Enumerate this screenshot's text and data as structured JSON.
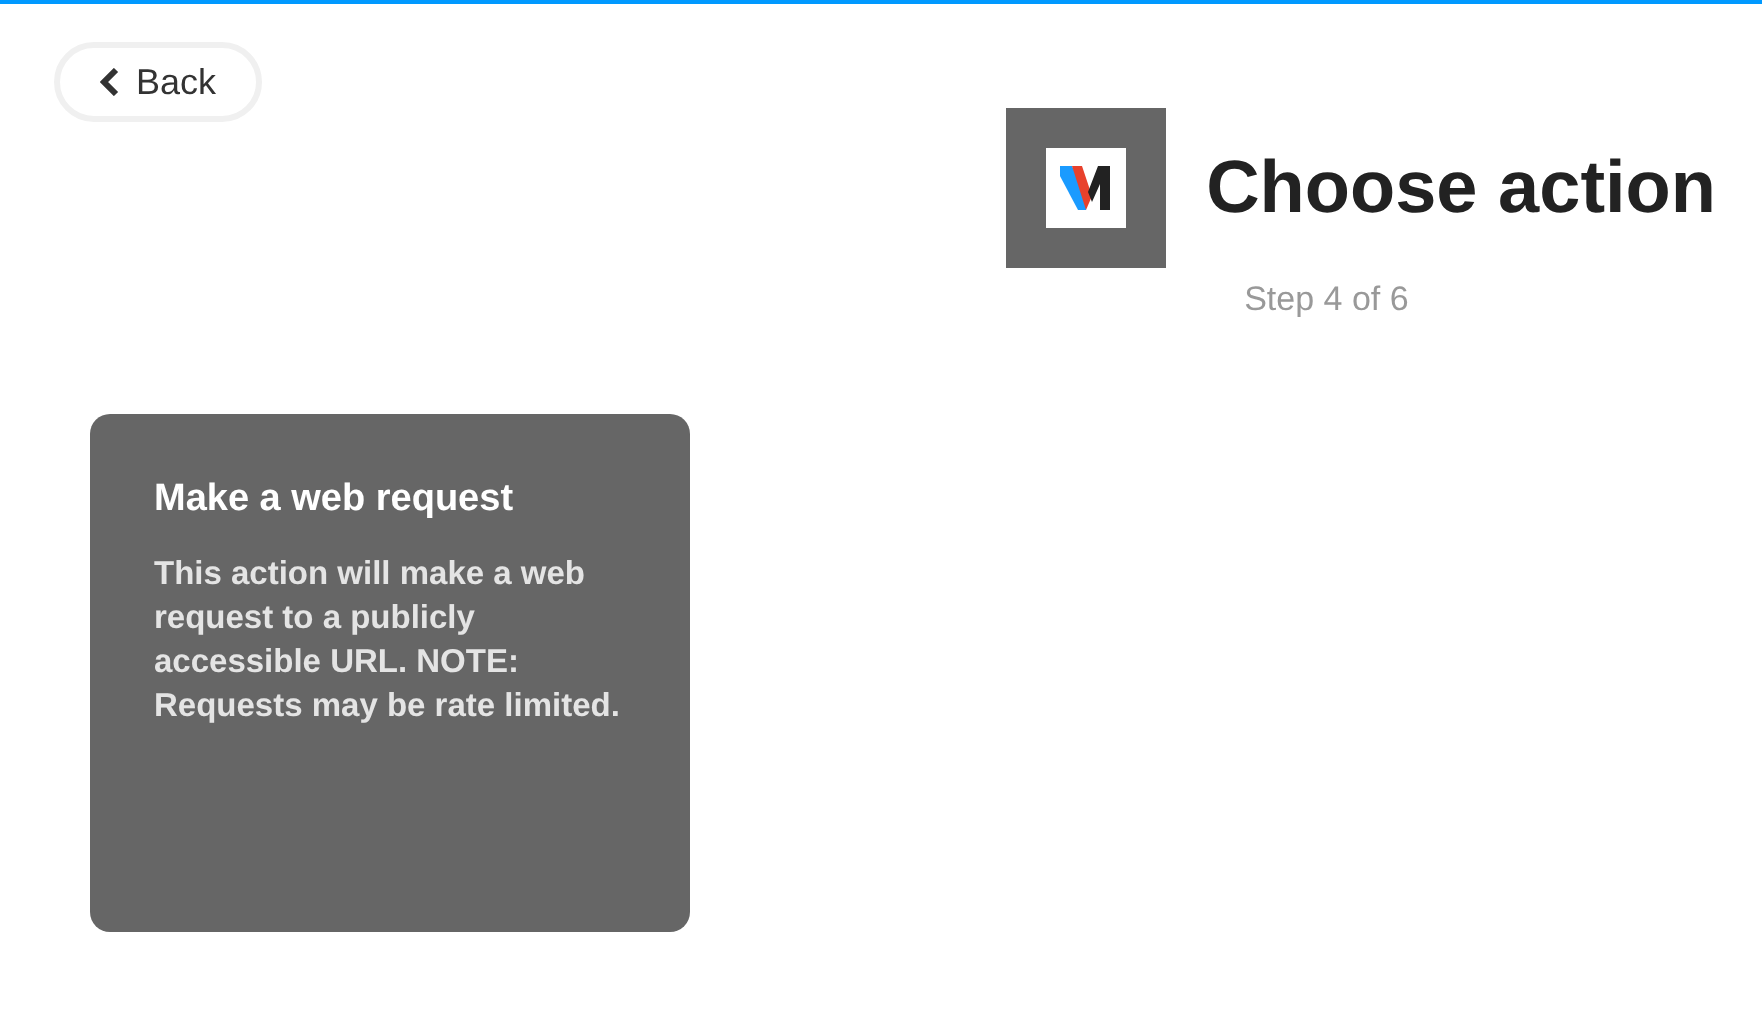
{
  "back_button": {
    "label": "Back"
  },
  "header": {
    "title": "Choose action",
    "step": "Step 4 of 6"
  },
  "actions": [
    {
      "title": "Make a web request",
      "description": "This action will make a web request to a publicly accessible URL. NOTE: Requests may be rate limited."
    }
  ]
}
